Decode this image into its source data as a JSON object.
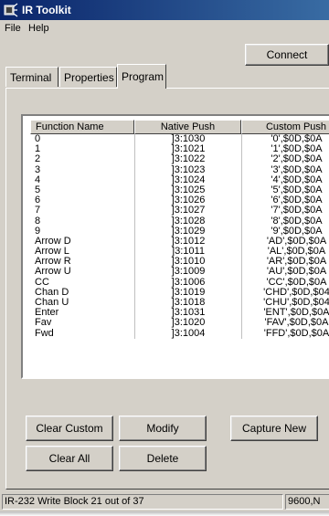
{
  "window": {
    "title": "IR Toolkit"
  },
  "menu": {
    "file": "File",
    "help": "Help"
  },
  "toolbar": {
    "connect_label": "Connect"
  },
  "tabs": [
    {
      "label": "Terminal"
    },
    {
      "label": "Properties"
    },
    {
      "label": "Program",
      "selected": true
    }
  ],
  "table": {
    "columns": [
      "Function Name",
      "Native Push",
      "Custom Push"
    ],
    "rows": [
      [
        "0",
        "]3:1030",
        "'0',$0D,$0A"
      ],
      [
        "1",
        "]3:1021",
        "'1',$0D,$0A"
      ],
      [
        "2",
        "]3:1022",
        "'2',$0D,$0A"
      ],
      [
        "3",
        "]3:1023",
        "'3',$0D,$0A"
      ],
      [
        "4",
        "]3:1024",
        "'4',$0D,$0A"
      ],
      [
        "5",
        "]3:1025",
        "'5',$0D,$0A"
      ],
      [
        "6",
        "]3:1026",
        "'6',$0D,$0A"
      ],
      [
        "7",
        "]3:1027",
        "'7',$0D,$0A"
      ],
      [
        "8",
        "]3:1028",
        "'8',$0D,$0A"
      ],
      [
        "9",
        "]3:1029",
        "'9',$0D,$0A"
      ],
      [
        "Arrow D",
        "]3:1012",
        "'AD',$0D,$0A"
      ],
      [
        "Arrow L",
        "]3:1011",
        "'AL',$0D,$0A"
      ],
      [
        "Arrow R",
        "]3:1010",
        "'AR',$0D,$0A"
      ],
      [
        "Arrow U",
        "]3:1009",
        "'AU',$0D,$0A"
      ],
      [
        "CC",
        "]3:1006",
        "'CC',$0D,$0A"
      ],
      [
        "Chan D",
        "]3:1019",
        "'CHD',$0D,$04"
      ],
      [
        "Chan U",
        "]3:1018",
        "'CHU',$0D,$04"
      ],
      [
        "Enter",
        "]3:1031",
        "'ENT',$0D,$0A"
      ],
      [
        "Fav",
        "]3:1020",
        "'FAV',$0D,$0A"
      ],
      [
        "Fwd",
        "]3:1004",
        "'FFD',$0D,$0A"
      ]
    ]
  },
  "buttons": {
    "clear_custom": "Clear Custom",
    "modify": "Modify",
    "capture_new": "Capture New",
    "clear_all": "Clear All",
    "delete": "Delete"
  },
  "status": {
    "message": "IR-232 Write Block 21 out of 37",
    "port": "9600,N"
  },
  "colors": {
    "titlebar_start": "#0a246a",
    "titlebar_end": "#3a6ea5",
    "face": "#d4d0c8"
  }
}
